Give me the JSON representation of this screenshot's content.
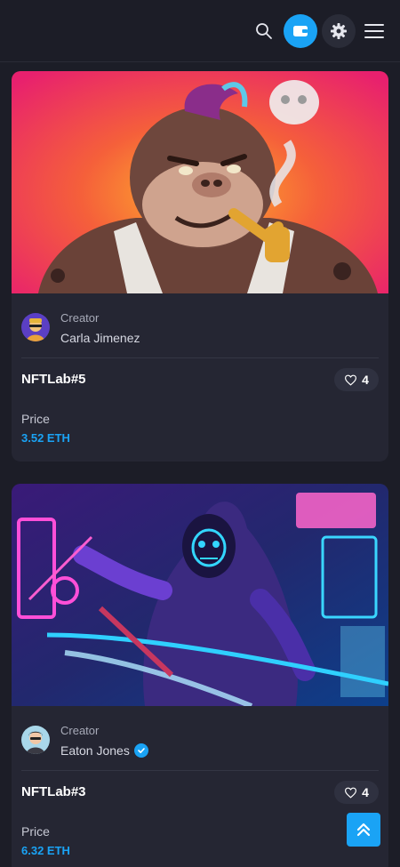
{
  "header": {
    "icons": [
      "search-icon",
      "wallet-icon",
      "gear-icon",
      "menu-icon"
    ],
    "accent": "#1aa3f5"
  },
  "cards": [
    {
      "art": "gorilla-smoking-pipe",
      "creator_label": "Creator",
      "creator_name": "Carla Jimenez",
      "verified": false,
      "title": "NFTLab#5",
      "likes": "4",
      "price_label": "Price",
      "price": "3.52 ETH"
    },
    {
      "art": "neon-cyber-ninja",
      "creator_label": "Creator",
      "creator_name": "Eaton Jones",
      "verified": true,
      "title": "NFTLab#3",
      "likes": "4",
      "price_label": "Price",
      "price": "6.32 ETH"
    }
  ],
  "colors": {
    "background": "#1c1d27",
    "card": "#252633",
    "price": "#1aa3f5"
  }
}
